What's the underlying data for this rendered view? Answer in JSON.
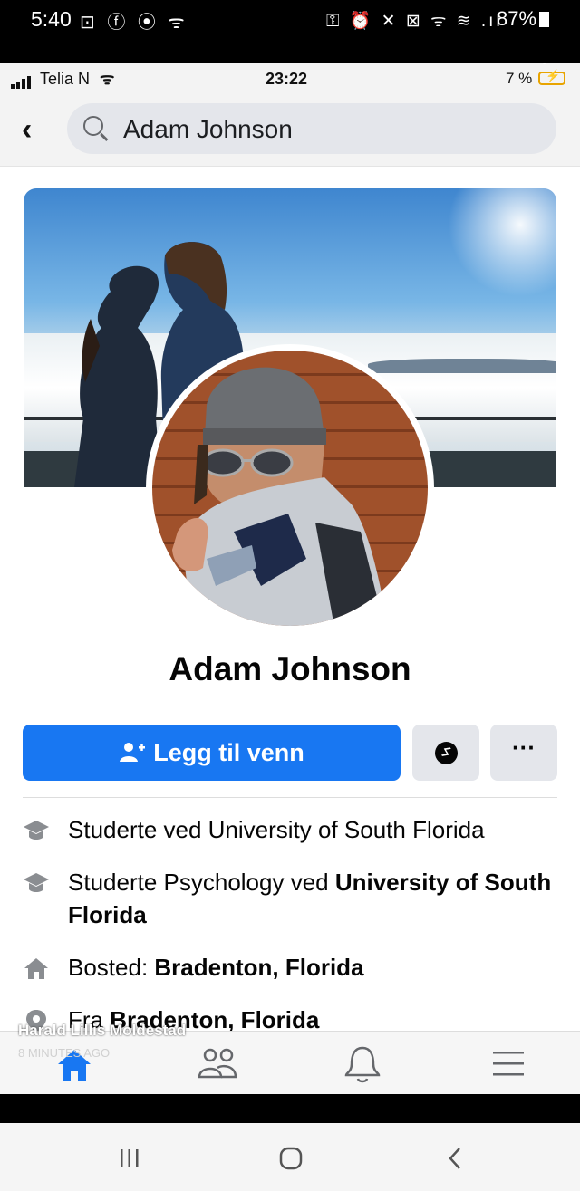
{
  "android_status": {
    "time": "5:40",
    "left_icons": "⊡ ⓕ ⦿ ᯤ",
    "right_icons": "⚿ ⏰ ✕ ⊠ ᯤ ≋ .ıl",
    "battery": "87%"
  },
  "ios_status": {
    "carrier": "Telia N",
    "time": "23:22",
    "battery": "7 %"
  },
  "header": {
    "search_text": "Adam Johnson"
  },
  "profile": {
    "name": "Adam Johnson",
    "add_friend_label": "Legg til venn",
    "more_label": "···"
  },
  "info": [
    {
      "text": "Studerte ved University of South Florida",
      "icon": "graduation-cap-icon"
    },
    {
      "prefix": "Studerte Psychology ved ",
      "bold": "University of South Florida",
      "icon": "graduation-cap-icon"
    },
    {
      "prefix": "Bosted: ",
      "bold": "Bradenton, Florida",
      "icon": "home-icon"
    },
    {
      "prefix": "Fra ",
      "bold": "Bradenton, Florida",
      "icon": "location-pin-icon"
    }
  ],
  "notification": {
    "name": "Harald Lillis Moldestad",
    "time": "8 MINUTES AGO"
  },
  "tabs": [
    "home-icon",
    "friends-icon",
    "bell-icon",
    "menu-icon"
  ],
  "colors": {
    "accent": "#1877f2",
    "button_grey": "#e4e6eb"
  }
}
